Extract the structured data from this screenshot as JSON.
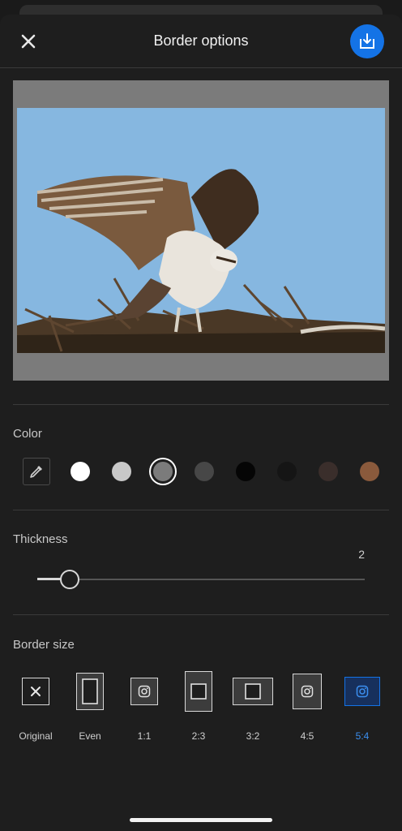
{
  "header": {
    "title": "Border options"
  },
  "icons": {
    "close": "close-icon",
    "export": "export-icon",
    "eyedropper": "eyedropper-icon",
    "instagram": "instagram-icon"
  },
  "color_section": {
    "label": "Color",
    "swatches": [
      {
        "name": "white",
        "hex": "#ffffff",
        "selected": false
      },
      {
        "name": "light-gray",
        "hex": "#c8c8c8",
        "selected": false
      },
      {
        "name": "mid-gray",
        "hex": "#7b7b7b",
        "selected": true
      },
      {
        "name": "dark-gray",
        "hex": "#474747",
        "selected": false
      },
      {
        "name": "black",
        "hex": "#050505",
        "selected": false
      },
      {
        "name": "near-black",
        "hex": "#151515",
        "selected": false
      },
      {
        "name": "dark-brown",
        "hex": "#3a2e2b",
        "selected": false
      },
      {
        "name": "brown",
        "hex": "#8a5a3c",
        "selected": false
      }
    ]
  },
  "thickness_section": {
    "label": "Thickness",
    "value": "2",
    "level": 0.1
  },
  "border_size_section": {
    "label": "Border size",
    "options": [
      {
        "label": "Original",
        "active": false
      },
      {
        "label": "Even",
        "active": false
      },
      {
        "label": "1:1",
        "active": false
      },
      {
        "label": "2:3",
        "active": false
      },
      {
        "label": "3:2",
        "active": false
      },
      {
        "label": "4:5",
        "active": false
      },
      {
        "label": "5:4",
        "active": true
      }
    ]
  },
  "colors": {
    "accent": "#1473e6",
    "background": "#1e1e1e",
    "border_fill": "#7b7b7b"
  }
}
